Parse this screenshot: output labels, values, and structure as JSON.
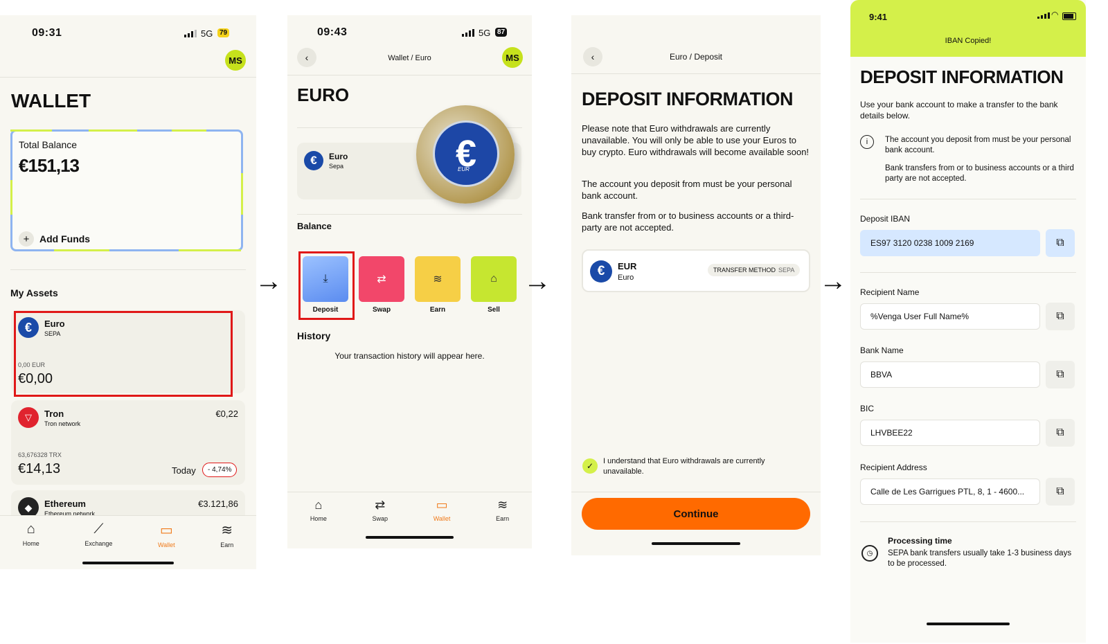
{
  "colors": {
    "accent_lime": "#d4f04a",
    "accent_orange": "#ff6a00",
    "euro_blue": "#1a4aa8",
    "highlight_red": "#e01818"
  },
  "screen1": {
    "time": "09:31",
    "network": "5G",
    "battery": "79",
    "avatar": "MS",
    "title": "WALLET",
    "total_balance_label": "Total Balance",
    "total_balance": "€151,13",
    "add_funds": "Add Funds",
    "my_assets": "My Assets",
    "assets": [
      {
        "name": "Euro",
        "sub": "SEPA",
        "amount_small": "0,00 EUR",
        "amount": "€0,00",
        "value": "",
        "icon": "euro-icon"
      },
      {
        "name": "Tron",
        "sub": "Tron network",
        "amount_small": "63,676328 TRX",
        "amount": "€14,13",
        "value": "€0,22",
        "today": "Today",
        "change": "- 4,74%",
        "icon": "tron-icon"
      },
      {
        "name": "Ethereum",
        "sub": "Ethereum network",
        "value": "€3.121,86",
        "icon": "ethereum-icon"
      }
    ],
    "tabs": [
      {
        "label": "Home",
        "icon": "home-icon"
      },
      {
        "label": "Exchange",
        "icon": "chart-icon"
      },
      {
        "label": "Wallet",
        "icon": "wallet-icon"
      },
      {
        "label": "Earn",
        "icon": "coins-icon"
      }
    ]
  },
  "screen2": {
    "time": "09:43",
    "network": "5G",
    "battery": "87",
    "avatar": "MS",
    "breadcrumb": "Wallet / Euro",
    "title": "EURO",
    "coin_name": "Euro",
    "coin_sub": "Sepa",
    "coin_label": "EUR",
    "balance": "Balance",
    "actions": [
      {
        "label": "Deposit",
        "icon": "download-icon"
      },
      {
        "label": "Swap",
        "icon": "swap-icon"
      },
      {
        "label": "Earn",
        "icon": "coins-icon"
      },
      {
        "label": "Sell",
        "icon": "tag-icon"
      }
    ],
    "history": "History",
    "history_empty": "Your transaction history will appear here.",
    "tabs": [
      {
        "label": "Home",
        "icon": "home-icon"
      },
      {
        "label": "Swap",
        "icon": "swap-icon"
      },
      {
        "label": "Wallet",
        "icon": "wallet-icon"
      },
      {
        "label": "Earn",
        "icon": "coins-icon"
      }
    ]
  },
  "screen3": {
    "breadcrumb": "Euro  /  Deposit",
    "title": "DEPOSIT INFORMATION",
    "p1": "Please note that Euro withdrawals are currently unavailable. You will only be able to use your Euros to buy crypto. Euro withdrawals will become available soon!",
    "p2": "The account you deposit from must be your personal bank account.",
    "p3": "Bank transfer from or to business accounts or a third-party are not accepted.",
    "currency_code": "EUR",
    "currency_name": "Euro",
    "transfer_method_label": "TRANSFER METHOD",
    "transfer_method": "SEPA",
    "ack": "I understand that Euro withdrawals are currently unavailable.",
    "continue": "Continue"
  },
  "screen4": {
    "time": "9:41",
    "toast": "IBAN Copied!",
    "title": "DEPOSIT INFORMATION",
    "intro": "Use your bank account to make a transfer to the bank details below.",
    "info1": "The account you deposit from must be your personal bank account.",
    "info2": "Bank transfers from or to business accounts or a third party are not accepted.",
    "fields": [
      {
        "label": "Deposit IBAN",
        "value": "ES97 3120 0238 1009 2169"
      },
      {
        "label": "Recipient Name",
        "value": "%Venga User Full Name%"
      },
      {
        "label": "Bank Name",
        "value": "BBVA"
      },
      {
        "label": "BIC",
        "value": "LHVBEE22"
      },
      {
        "label": "Recipient Address",
        "value": "Calle de Les Garrigues PTL, 8, 1 - 4600..."
      }
    ],
    "processing_title": "Processing time",
    "processing_text": "SEPA bank transfers usually take 1-3 business days to be processed."
  }
}
